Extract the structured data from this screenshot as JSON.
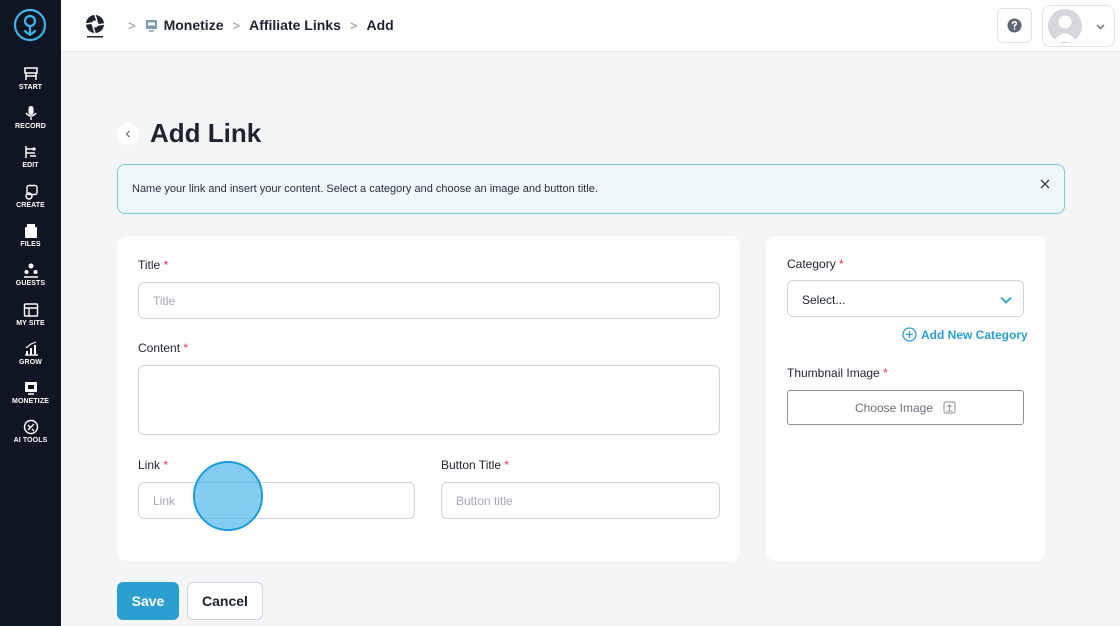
{
  "sidebar": {
    "items": [
      {
        "label": "START"
      },
      {
        "label": "RECORD"
      },
      {
        "label": "EDIT"
      },
      {
        "label": "CREATE"
      },
      {
        "label": "FILES"
      },
      {
        "label": "GUESTS"
      },
      {
        "label": "MY SITE"
      },
      {
        "label": "GROW"
      },
      {
        "label": "MONETIZE"
      },
      {
        "label": "AI TOOLS"
      }
    ]
  },
  "breadcrumb": {
    "items": [
      "Monetize",
      "Affiliate Links",
      "Add"
    ],
    "separator": ">"
  },
  "page": {
    "title": "Add Link"
  },
  "banner": {
    "text": "Name your link and insert your content. Select a category and choose an image and button title."
  },
  "form": {
    "required_mark": "*",
    "title": {
      "label": "Title",
      "placeholder": "Title",
      "value": ""
    },
    "content": {
      "label": "Content",
      "value": ""
    },
    "link": {
      "label": "Link",
      "placeholder": "Link",
      "value": ""
    },
    "button_title": {
      "label": "Button Title",
      "placeholder": "Button title",
      "value": ""
    }
  },
  "side": {
    "category": {
      "label": "Category",
      "selected": "Select..."
    },
    "add_category_label": "Add New Category",
    "thumbnail": {
      "label": "Thumbnail Image",
      "button_label": "Choose Image"
    }
  },
  "actions": {
    "save_label": "Save",
    "cancel_label": "Cancel"
  },
  "colors": {
    "sidebar_bg": "#0f1523",
    "accent": "#2a9fd0",
    "banner_bg": "#eef9fb",
    "banner_border": "#7ccbd9",
    "required": "#e53935"
  }
}
